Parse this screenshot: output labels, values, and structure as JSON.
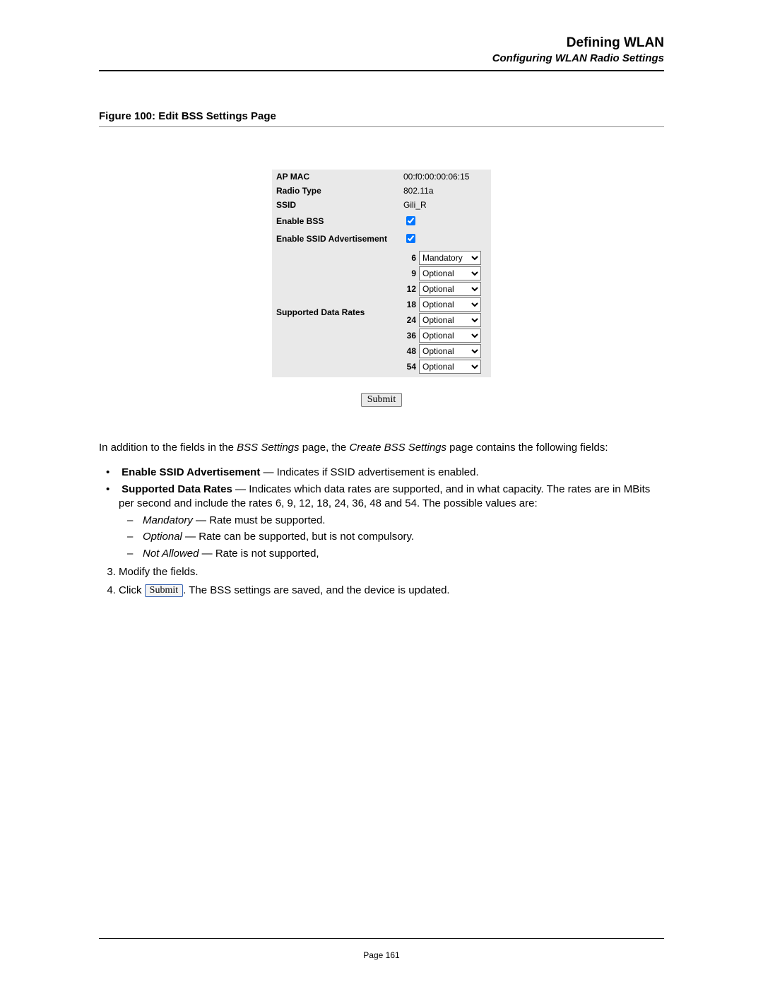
{
  "header": {
    "title": "Defining WLAN",
    "subtitle": "Configuring WLAN Radio Settings"
  },
  "figure": {
    "caption": "Figure 100: Edit BSS Settings Page"
  },
  "settings": {
    "ap_mac": {
      "label": "AP MAC",
      "value": "00:f0:00:00:06:15"
    },
    "radio_type": {
      "label": "Radio Type",
      "value": "802.11a"
    },
    "ssid": {
      "label": "SSID",
      "value": "Gili_R"
    },
    "enable_bss": {
      "label": "Enable BSS",
      "checked": true
    },
    "enable_ssid_adv": {
      "label": "Enable SSID Advertisement",
      "checked": true
    },
    "rates_label": "Supported Data Rates",
    "rates": [
      {
        "rate": "6",
        "value": "Mandatory"
      },
      {
        "rate": "9",
        "value": "Optional"
      },
      {
        "rate": "12",
        "value": "Optional"
      },
      {
        "rate": "18",
        "value": "Optional"
      },
      {
        "rate": "24",
        "value": "Optional"
      },
      {
        "rate": "36",
        "value": "Optional"
      },
      {
        "rate": "48",
        "value": "Optional"
      },
      {
        "rate": "54",
        "value": "Optional"
      }
    ],
    "rate_options": [
      "Mandatory",
      "Optional",
      "Not Allowed"
    ],
    "submit_label": "Submit"
  },
  "body": {
    "intro_1": "In addition to the fields in the ",
    "intro_em1": "BSS Settings",
    "intro_2": " page, the ",
    "intro_em2": "Create BSS Settings",
    "intro_3": " page contains the following fields:",
    "b1_bold": "Enable SSID Advertisement",
    "b1_rest": " — Indicates if SSID advertisement is enabled.",
    "b2_bold": "Supported Data Rates",
    "b2_rest_a": " — Indicates which data rates are supported, and in what capacity. The rates are in MBits per second and include the rates 6, 9, 12, 18, 24, 36, 48 and 54. The possible values are:",
    "d1_em": "Mandatory",
    "d1_rest": " — Rate must be supported.",
    "d2_em": "Optional",
    "d2_rest": " — Rate can be supported, but is not compulsory.",
    "d3_em": "Not Allowed",
    "d3_rest": " — Rate is not supported,",
    "step3": "Modify the fields.",
    "step4_a": "Click ",
    "step4_btn": "Submit",
    "step4_b": ". The BSS settings are saved, and the device is updated."
  },
  "footer": {
    "page": "Page 161"
  }
}
